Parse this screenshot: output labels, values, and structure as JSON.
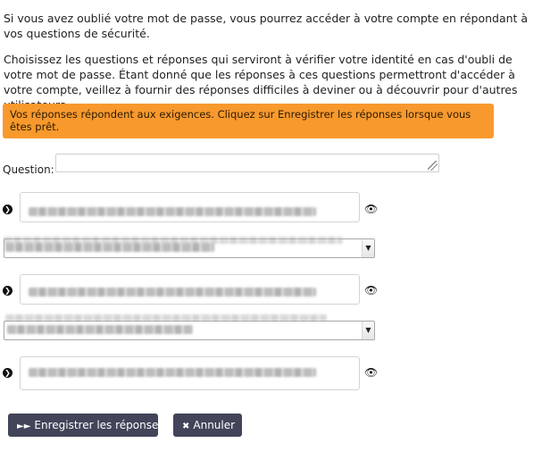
{
  "intro": {
    "paragraph1": "Si vous avez oublié votre mot de passe, vous pourrez accéder à votre compte en répondant à vos questions de sécurité.",
    "paragraph2": "Choisissez les questions et réponses qui serviront à vérifier votre identité en cas d'oubli de votre mot de passe. Étant donné que les réponses à ces questions permettront d'accéder à votre compte, veillez à fournir des réponses difficiles à deviner ou à découvrir pour d'autres utilisateurs."
  },
  "alert": {
    "text": "Vos réponses répondent aux exigences. Cliquez sur Enregistrer les réponses lorsque vous êtes prêt.",
    "color": "#f8992d"
  },
  "question": {
    "label": "Question:"
  },
  "icons": {
    "bullet": "arrow-circle-icon",
    "reveal": "eye-icon"
  },
  "buttons": {
    "save_label": "Enregistrer les réponses",
    "cancel_label": "Annuler",
    "color": "#42445a"
  }
}
